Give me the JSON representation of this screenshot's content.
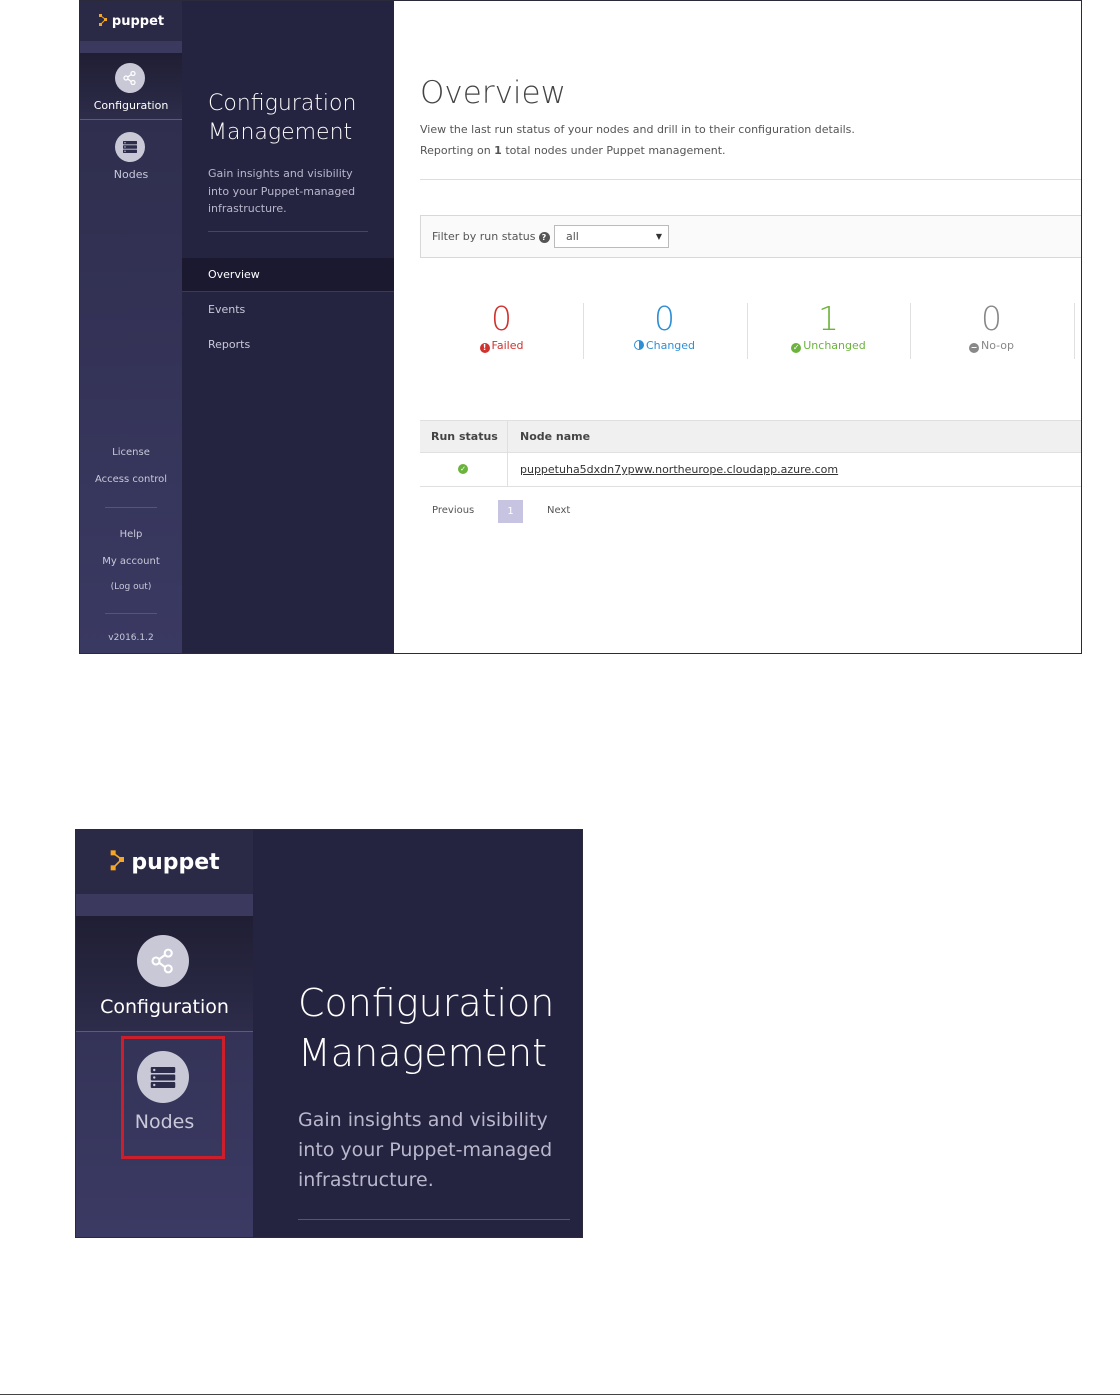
{
  "brand": {
    "logo_text": "puppet",
    "logo_color": "#f5a623"
  },
  "rail": {
    "configuration_label": "Configuration",
    "nodes_label": "Nodes",
    "license_label": "License",
    "access_control_label": "Access control",
    "help_label": "Help",
    "my_account_label": "My account",
    "logout_label": "(Log out)",
    "version": "v2016.1.2"
  },
  "section": {
    "title_line1": "Configuration",
    "title_line2": "Management",
    "desc_line1": "Gain insights and visibility",
    "desc_line2": "into your Puppet-managed",
    "desc_line3": "infrastructure.",
    "nav": [
      "Overview",
      "Events",
      "Reports"
    ]
  },
  "overview": {
    "title": "Overview",
    "desc1": "View the last run status of your nodes and drill in to their configuration details.",
    "desc2_prefix": "Reporting on ",
    "desc2_count": "1",
    "desc2_suffix": " total nodes under Puppet management.",
    "filter_label": "Filter by run status",
    "filter_value": "all"
  },
  "stats": [
    {
      "count": "0",
      "label": "Failed",
      "color": "#d0322e"
    },
    {
      "count": "0",
      "label": "Changed",
      "color": "#2e8ed6"
    },
    {
      "count": "1",
      "label": "Unchanged",
      "color": "#6bb33d"
    },
    {
      "count": "0",
      "label": "No-op",
      "color": "#888888"
    }
  ],
  "table": {
    "col_run_status": "Run status",
    "col_node_name": "Node name",
    "rows": [
      {
        "status": "unchanged",
        "node": "puppetuha5dxdn7ypww.northeurope.cloudapp.azure.com"
      }
    ]
  },
  "pagination": {
    "previous": "Previous",
    "page": "1",
    "next": "Next"
  },
  "highlight_color": "#cc1f2b"
}
